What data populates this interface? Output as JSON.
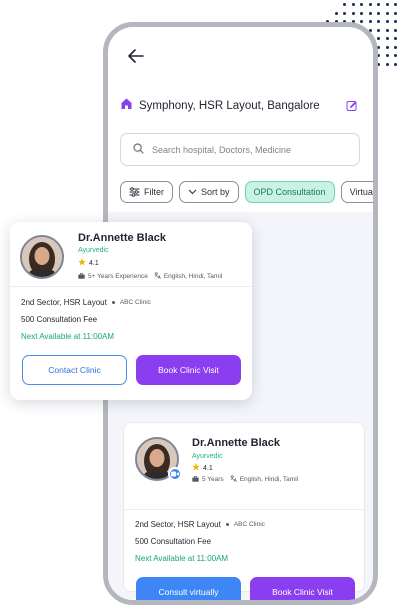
{
  "header": {
    "back_icon": "arrow-left-icon",
    "location": "Symphony, HSR Layout, Bangalore",
    "location_icon": "home-icon",
    "edit_icon": "edit-icon"
  },
  "search": {
    "placeholder": "Search hospital, Doctors, Medicine",
    "icon": "search-icon"
  },
  "filters": {
    "filter_label": "Filter",
    "sort_label": "Sort by",
    "opd_label": "OPD Consultation",
    "virtual_label": "Virtual"
  },
  "cards": [
    {
      "name": "Dr.Annette Black",
      "specialty": "Ayurvedic",
      "rating": "4.1",
      "experience": "5+ Years Experience",
      "languages": "English, Hindi, Tamil",
      "address": "2nd Sector, HSR Layout",
      "clinic": "ABC Clinic",
      "fee": "500 Consultation Fee",
      "availability": "Next Available at 11:00AM",
      "secondary_button": "Contact Clinic",
      "primary_button": "Book Clinic Visit"
    },
    {
      "name": "Dr.Annette Black",
      "specialty": "Ayurvedic",
      "rating": "4.1",
      "experience": "5 Years",
      "languages": "English, Hindi, Tamil",
      "address": "2nd Sector, HSR Layout",
      "clinic": "ABC Clinic",
      "fee": "500 Consultation Fee",
      "availability": "Next Available at 11:00AM",
      "secondary_button": "Consult virtually",
      "primary_button": "Book Clinic Visit"
    }
  ],
  "colors": {
    "accent_purple": "#8b3df0",
    "accent_blue": "#3e86f5",
    "available_green": "#18a66f",
    "chip_active_bg": "#c8f2e2",
    "star": "#f4b400"
  }
}
